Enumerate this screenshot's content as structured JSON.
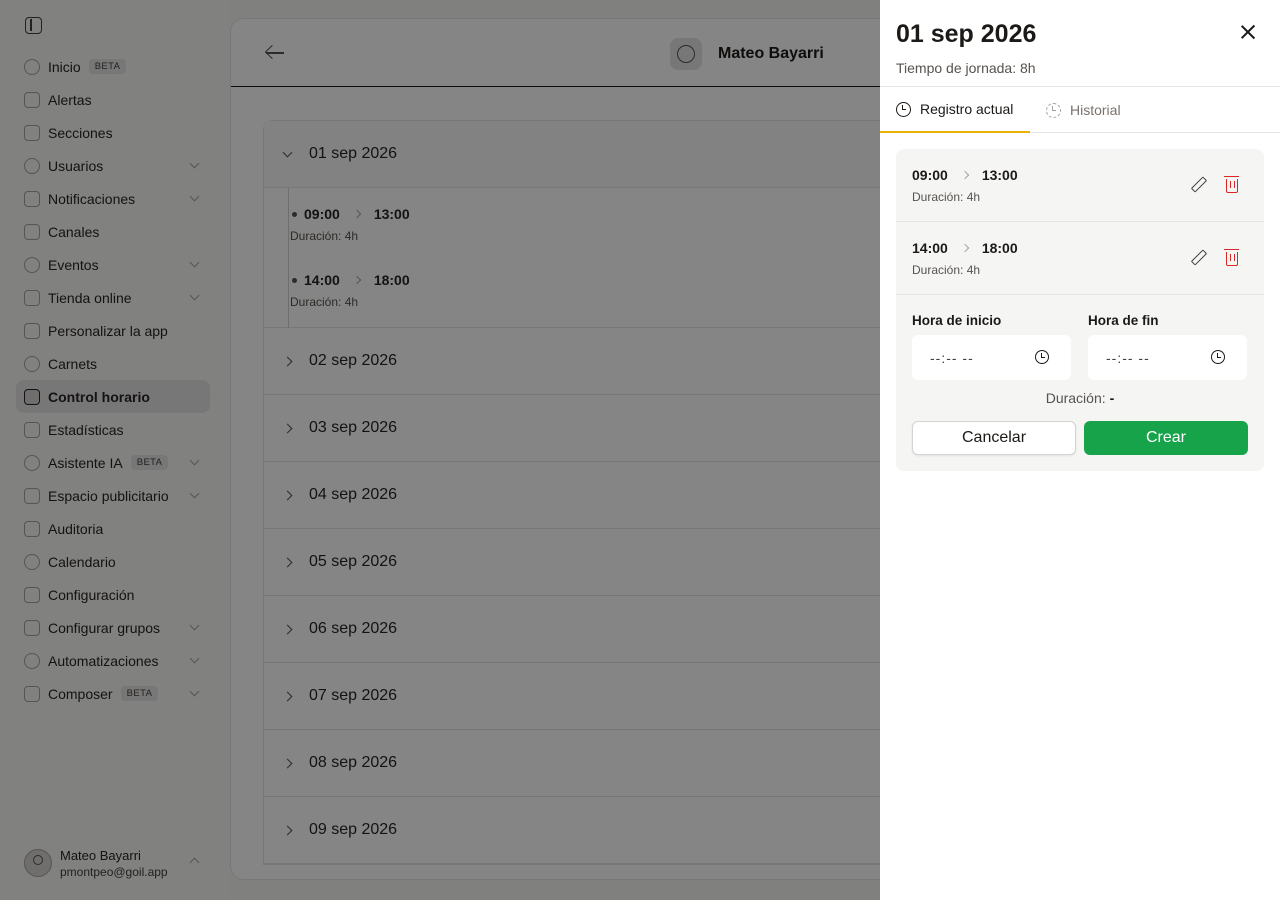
{
  "sidebar": {
    "items": [
      {
        "label": "Inicio",
        "badge": "BETA",
        "chevron": false
      },
      {
        "label": "Alertas",
        "badge": "",
        "chevron": false
      },
      {
        "label": "Secciones",
        "badge": "",
        "chevron": false
      },
      {
        "label": "Usuarios",
        "badge": "",
        "chevron": true
      },
      {
        "label": "Notificaciones",
        "badge": "",
        "chevron": true
      },
      {
        "label": "Canales",
        "badge": "",
        "chevron": false
      },
      {
        "label": "Eventos",
        "badge": "",
        "chevron": true
      },
      {
        "label": "Tienda online",
        "badge": "",
        "chevron": true
      },
      {
        "label": "Personalizar la app",
        "badge": "",
        "chevron": false
      },
      {
        "label": "Carnets",
        "badge": "",
        "chevron": false
      },
      {
        "label": "Control horario",
        "badge": "",
        "chevron": false,
        "active": true
      },
      {
        "label": "Estadísticas",
        "badge": "",
        "chevron": false
      },
      {
        "label": "Asistente IA",
        "badge": "BETA",
        "chevron": true
      },
      {
        "label": "Espacio publicitario",
        "badge": "",
        "chevron": true
      },
      {
        "label": "Auditoria",
        "badge": "",
        "chevron": false
      },
      {
        "label": "Calendario",
        "badge": "",
        "chevron": false
      },
      {
        "label": "Configuración",
        "badge": "",
        "chevron": false
      },
      {
        "label": "Configurar grupos",
        "badge": "",
        "chevron": true
      },
      {
        "label": "Automatizaciones",
        "badge": "",
        "chevron": true
      },
      {
        "label": "Composer",
        "badge": "BETA",
        "chevron": true
      }
    ],
    "user": {
      "name": "Mateo Bayarri",
      "email": "pmontpeo@goil.app"
    }
  },
  "main": {
    "header_title": "Mateo Bayarri",
    "open_day": {
      "label": "01 sep 2026",
      "entries": [
        {
          "start": "09:00",
          "end": "13:00",
          "duration": "Duración: 4h"
        },
        {
          "start": "14:00",
          "end": "18:00",
          "duration": "Duración: 4h"
        }
      ]
    },
    "days": [
      "02 sep 2026",
      "03 sep 2026",
      "04 sep 2026",
      "05 sep 2026",
      "06 sep 2026",
      "07 sep 2026",
      "08 sep 2026",
      "09 sep 2026"
    ]
  },
  "drawer": {
    "title": "01 sep 2026",
    "subtitle": "Tiempo de jornada: 8h",
    "tabs": {
      "current": "Registro actual",
      "history": "Historial"
    },
    "records": [
      {
        "start": "09:00",
        "end": "13:00",
        "duration": "Duración: 4h"
      },
      {
        "start": "14:00",
        "end": "18:00",
        "duration": "Duración: 4h"
      }
    ],
    "form": {
      "start_label": "Hora de inicio",
      "end_label": "Hora de fin",
      "start_value": "--:-- --",
      "end_value": "--:-- --",
      "duration_label": "Duración:",
      "duration_value": "-",
      "cancel": "Cancelar",
      "create": "Crear"
    }
  },
  "colors": {
    "accent_tab": "#eab308",
    "create_button": "#16a34a",
    "delete_icon": "#dc2626"
  }
}
